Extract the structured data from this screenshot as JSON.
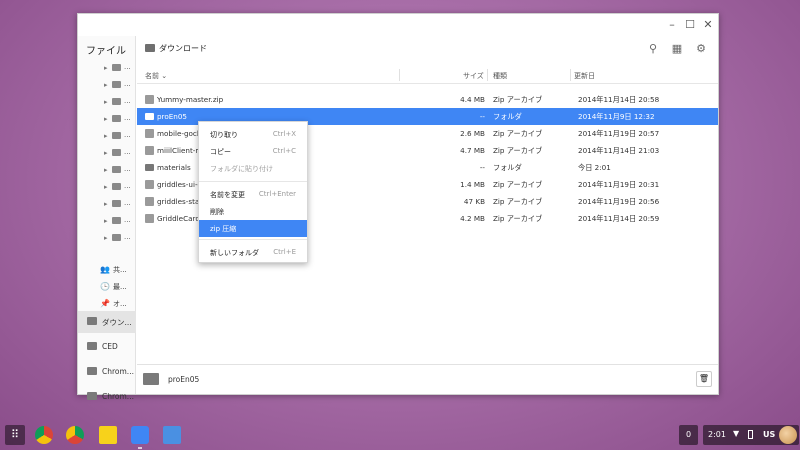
{
  "window": {
    "controls": {
      "minimize": "–",
      "maximize": "☐",
      "close": "✕"
    }
  },
  "sidebar": {
    "title": "ファイル",
    "tree_items": [
      {
        "arrow": "▸",
        "dots": "..."
      },
      {
        "arrow": "▸",
        "dots": "..."
      },
      {
        "arrow": "▸",
        "dots": "..."
      },
      {
        "arrow": "▸",
        "dots": "..."
      },
      {
        "arrow": "▸",
        "dots": "..."
      },
      {
        "arrow": "▸",
        "dots": "..."
      },
      {
        "arrow": "▸",
        "dots": "..."
      },
      {
        "arrow": "▸",
        "dots": "..."
      },
      {
        "arrow": "▸",
        "dots": "..."
      },
      {
        "arrow": "▸",
        "dots": "..."
      },
      {
        "arrow": "▸",
        "dots": "..."
      }
    ],
    "shortcuts": [
      {
        "icon": "👥",
        "label": "共..."
      },
      {
        "icon": "🕒",
        "label": "最..."
      },
      {
        "icon": "📌",
        "label": "オ..."
      }
    ],
    "volumes": [
      {
        "label": "ダウン..."
      },
      {
        "label": "CED"
      },
      {
        "label": "Chrom..."
      },
      {
        "label": "Chrom..."
      }
    ]
  },
  "toolbar": {
    "breadcrumb": "ダウンロード",
    "search_icon": "⚲",
    "grid_icon": "▦",
    "settings_icon": "⚙"
  },
  "columns": {
    "name": "名前 ⌄",
    "size": "サイズ",
    "type": "種類",
    "date": "更新日"
  },
  "files": [
    {
      "name": "Yummy-master.zip",
      "size": "4.4 MB",
      "type": "Zip アーカイブ",
      "date": "2014年11月14日 20:58",
      "kind": "zip"
    },
    {
      "name": "proEn05",
      "size": "--",
      "type": "フォルダ",
      "date": "2014年11月9日 12:32",
      "kind": "folder",
      "selected": true
    },
    {
      "name": "mobile-gochi",
      "size": "2.6 MB",
      "type": "Zip アーカイブ",
      "date": "2014年11月19日 20:57",
      "kind": "zip"
    },
    {
      "name": "miiilClient-ma",
      "size": "4.7 MB",
      "type": "Zip アーカイブ",
      "date": "2014年11月14日 21:03",
      "kind": "zip"
    },
    {
      "name": "materials",
      "size": "--",
      "type": "フォルダ",
      "date": "今日 2:01",
      "kind": "folder"
    },
    {
      "name": "griddles-ui-ca",
      "size": "1.4 MB",
      "type": "Zip アーカイブ",
      "date": "2014年11月19日 20:31",
      "kind": "zip"
    },
    {
      "name": "griddles-stab",
      "size": "47 KB",
      "type": "Zip アーカイブ",
      "date": "2014年11月19日 20:56",
      "kind": "zip"
    },
    {
      "name": "GriddleCardb",
      "size": "4.2 MB",
      "type": "Zip アーカイブ",
      "date": "2014年11月14日 20:59",
      "kind": "zip"
    }
  ],
  "context_menu": {
    "items": [
      {
        "label": "切り取り",
        "shortcut": "Ctrl+X"
      },
      {
        "label": "コピー",
        "shortcut": "Ctrl+C"
      },
      {
        "label": "フォルダに貼り付け",
        "shortcut": ""
      },
      {
        "label": "名前を変更",
        "shortcut": "Ctrl+Enter"
      },
      {
        "label": "削除",
        "shortcut": ""
      },
      {
        "label": "zip 圧縮",
        "shortcut": ""
      },
      {
        "label": "新しいフォルダ",
        "shortcut": "Ctrl+E"
      }
    ]
  },
  "footer": {
    "selected_name": "proEn05",
    "trash_icon": "🗑"
  },
  "shelf": {
    "launcher_icon": "⠿",
    "notification_count": "0",
    "time": "2:01",
    "wifi_icon": "▼",
    "keyboard": "US"
  },
  "colors": {
    "selection": "#3f86f4",
    "desktop": "#a86ea8"
  }
}
